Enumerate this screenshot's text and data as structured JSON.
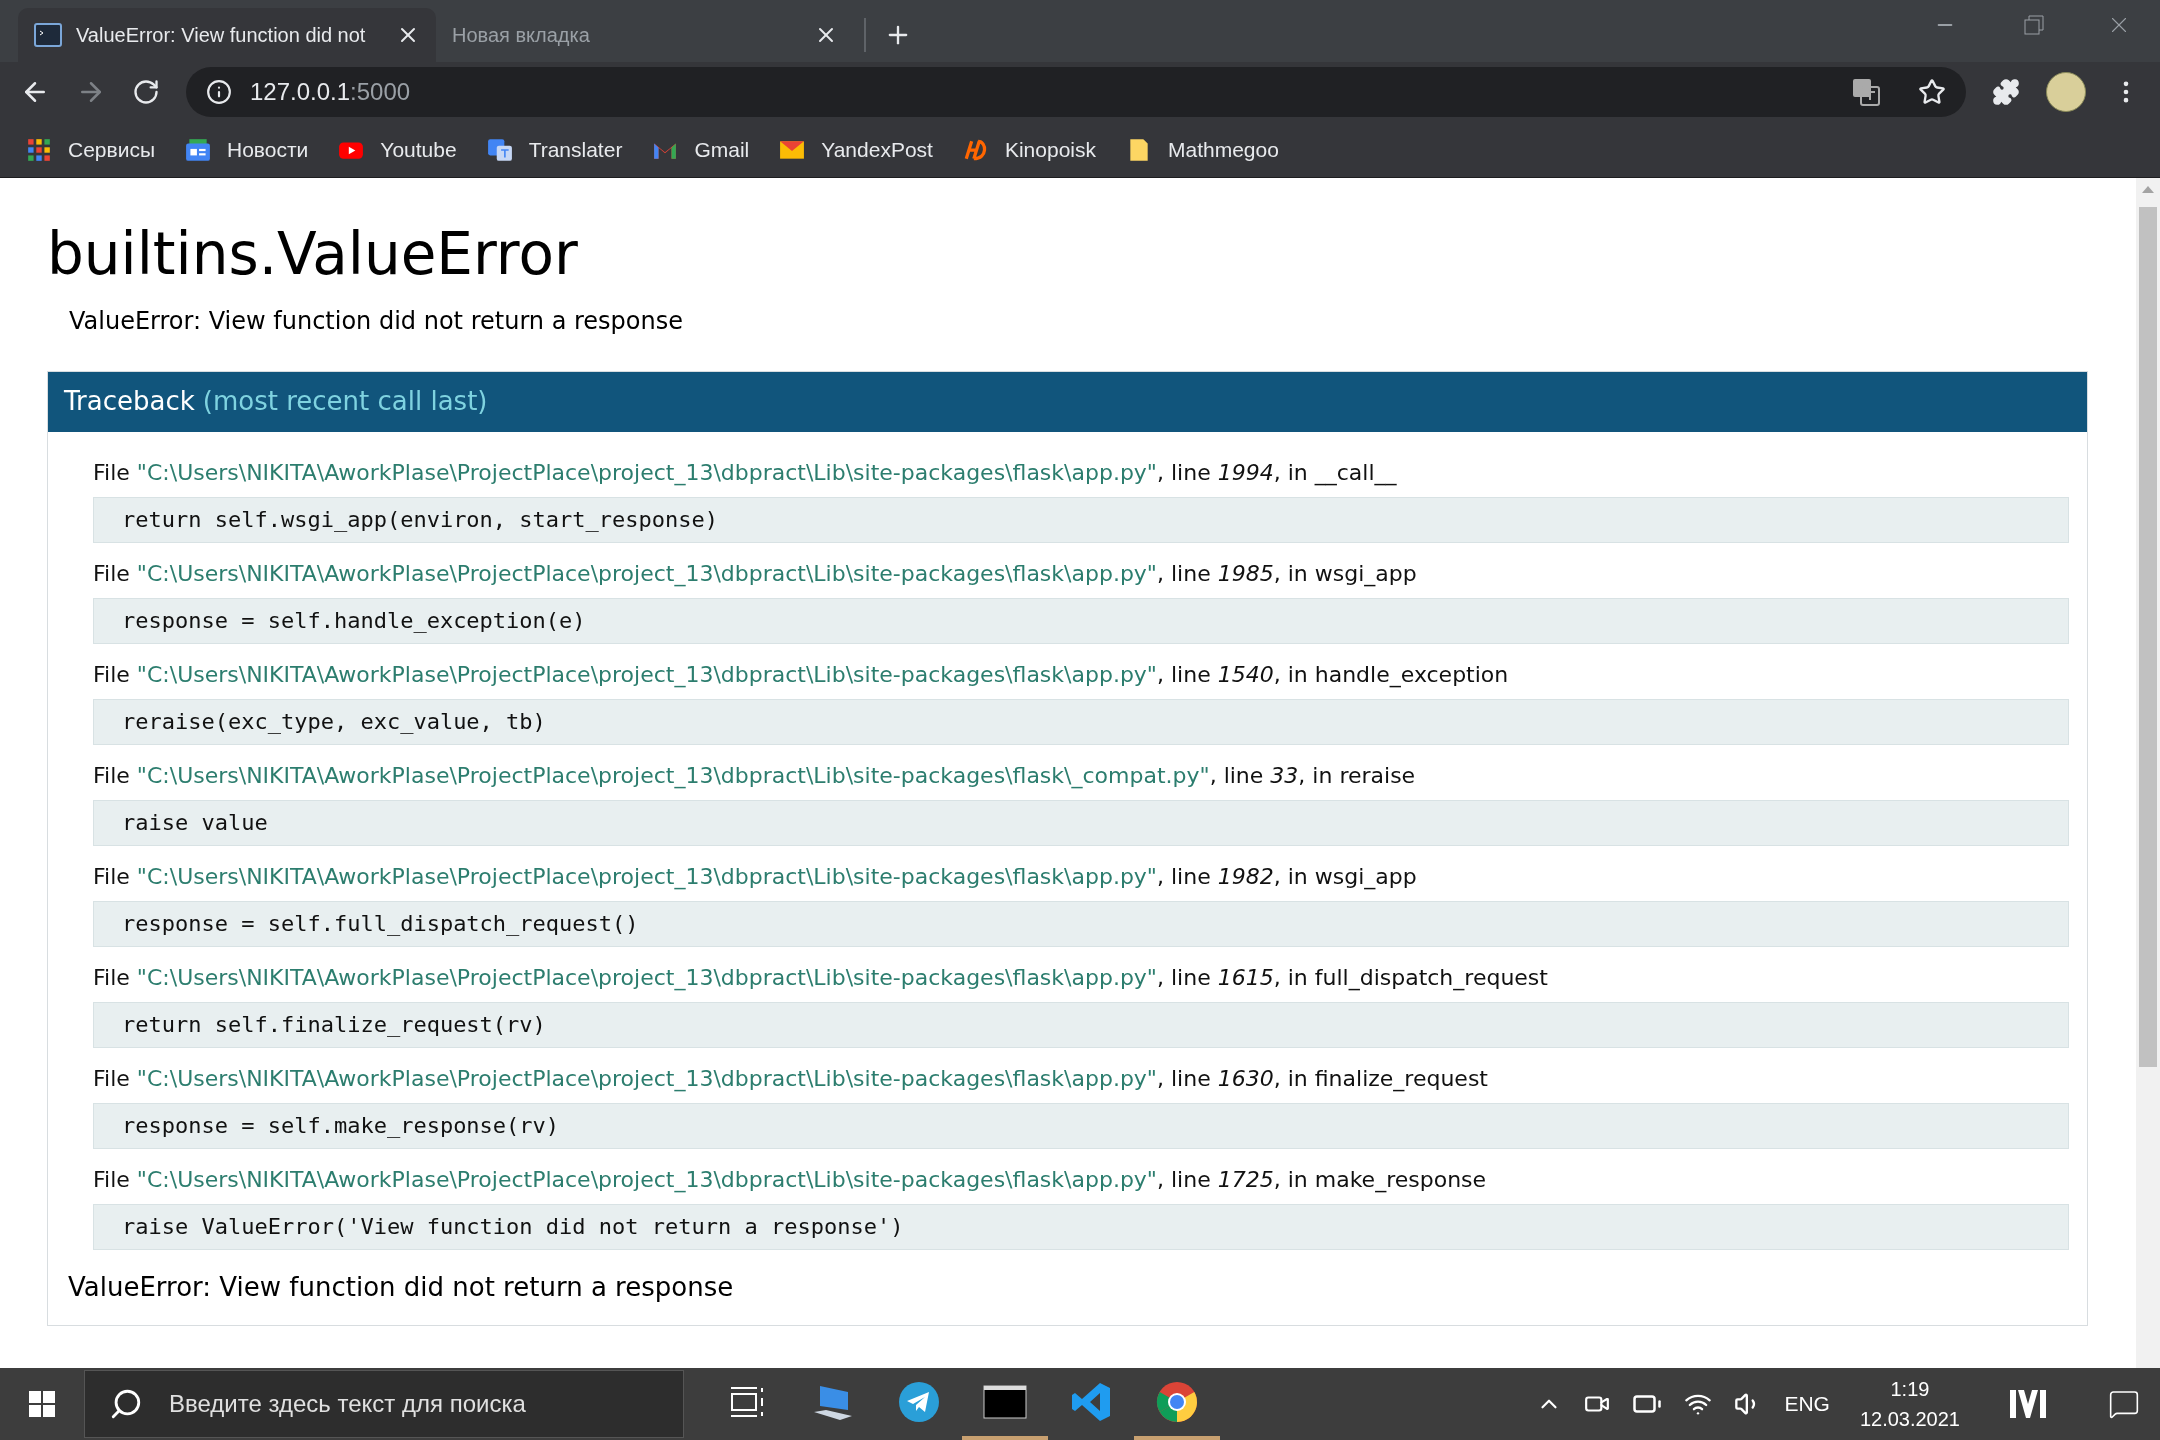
{
  "browser": {
    "tabs": [
      {
        "title": "ValueError: View function did not",
        "selected": true
      },
      {
        "title": "Новая вкладка",
        "selected": false
      }
    ],
    "address": {
      "host": "127.0.0.1",
      "port": ":5000"
    },
    "bookmarks": [
      {
        "label": "Сервисы"
      },
      {
        "label": "Новости"
      },
      {
        "label": "Youtube"
      },
      {
        "label": "Translater"
      },
      {
        "label": "Gmail"
      },
      {
        "label": "YandexPost"
      },
      {
        "label": "Kinopoisk"
      },
      {
        "label": "Mathmegoo"
      }
    ]
  },
  "page": {
    "title": "builtins.ValueError",
    "message": "ValueError: View function did not return a response",
    "traceback": {
      "heading": "Traceback",
      "note": "(most recent call last)"
    },
    "frames": [
      {
        "file_label": "File",
        "path": "\"C:\\Users\\NIKITA\\AworkPlase\\ProjectPlace\\project_13\\dbpract\\Lib\\site-packages\\flask\\app.py\"",
        "line_label": ", line",
        "line": "1994",
        "in_label": ", in",
        "function": "__call__",
        "code": "return self.wsgi_app(environ, start_response)"
      },
      {
        "file_label": "File",
        "path": "\"C:\\Users\\NIKITA\\AworkPlase\\ProjectPlace\\project_13\\dbpract\\Lib\\site-packages\\flask\\app.py\"",
        "line_label": ", line",
        "line": "1985",
        "in_label": ", in",
        "function": "wsgi_app",
        "code": "response = self.handle_exception(e)"
      },
      {
        "file_label": "File",
        "path": "\"C:\\Users\\NIKITA\\AworkPlase\\ProjectPlace\\project_13\\dbpract\\Lib\\site-packages\\flask\\app.py\"",
        "line_label": ", line",
        "line": "1540",
        "in_label": ", in",
        "function": "handle_exception",
        "code": "reraise(exc_type, exc_value, tb)"
      },
      {
        "file_label": "File",
        "path": "\"C:\\Users\\NIKITA\\AworkPlase\\ProjectPlace\\project_13\\dbpract\\Lib\\site-packages\\flask\\_compat.py\"",
        "line_label": ", line",
        "line": "33",
        "in_label": ", in",
        "function": "reraise",
        "code": "raise value"
      },
      {
        "file_label": "File",
        "path": "\"C:\\Users\\NIKITA\\AworkPlase\\ProjectPlace\\project_13\\dbpract\\Lib\\site-packages\\flask\\app.py\"",
        "line_label": ", line",
        "line": "1982",
        "in_label": ", in",
        "function": "wsgi_app",
        "code": "response = self.full_dispatch_request()"
      },
      {
        "file_label": "File",
        "path": "\"C:\\Users\\NIKITA\\AworkPlase\\ProjectPlace\\project_13\\dbpract\\Lib\\site-packages\\flask\\app.py\"",
        "line_label": ", line",
        "line": "1615",
        "in_label": ", in",
        "function": "full_dispatch_request",
        "code": "return self.finalize_request(rv)"
      },
      {
        "file_label": "File",
        "path": "\"C:\\Users\\NIKITA\\AworkPlase\\ProjectPlace\\project_13\\dbpract\\Lib\\site-packages\\flask\\app.py\"",
        "line_label": ", line",
        "line": "1630",
        "in_label": ", in",
        "function": "finalize_request",
        "code": "response = self.make_response(rv)"
      },
      {
        "file_label": "File",
        "path": "\"C:\\Users\\NIKITA\\AworkPlase\\ProjectPlace\\project_13\\dbpract\\Lib\\site-packages\\flask\\app.py\"",
        "line_label": ", line",
        "line": "1725",
        "in_label": ", in",
        "function": "make_response",
        "code": "raise ValueError('View function did not return a response')"
      }
    ],
    "footer_message": "ValueError: View function did not return a response"
  },
  "taskbar": {
    "search_placeholder": "Введите здесь текст для поиска",
    "apps": [
      {
        "running": false
      },
      {
        "running": false
      },
      {
        "running": false
      },
      {
        "running": true
      },
      {
        "running": false
      },
      {
        "running": true
      }
    ],
    "language": "ENG",
    "time": "1:19",
    "date": "12.03.2021"
  }
}
